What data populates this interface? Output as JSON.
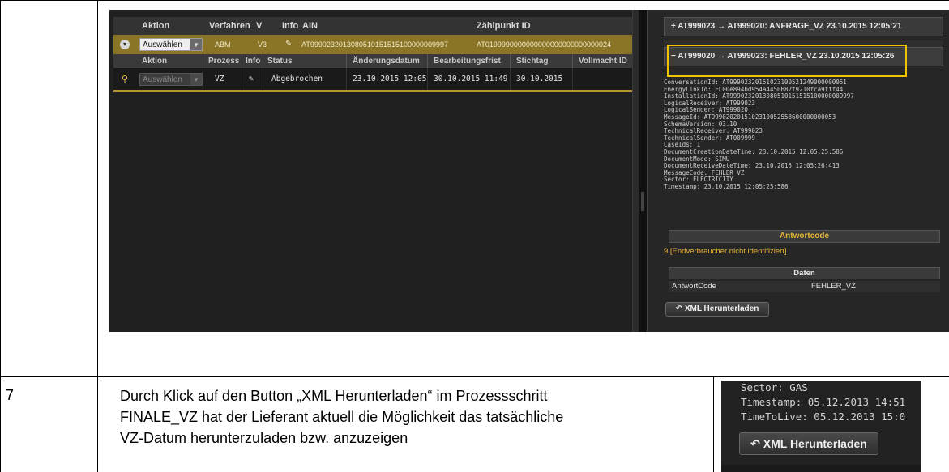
{
  "top_table": {
    "headers": [
      "Aktion",
      "Verfahren",
      "V",
      "Info",
      "AIN",
      "Zählpunkt ID"
    ],
    "row": {
      "action_select": "Auswählen",
      "verfahren": "ABM",
      "version": "V3",
      "ain": "AT9990232013080510151515100000009997",
      "zaehlpunkt": "AT0199990000000000000000000000024"
    }
  },
  "sub_table": {
    "headers": [
      "Aktion",
      "Prozess",
      "Info",
      "Status",
      "Änderungsdatum",
      "Bearbeitungsfrist",
      "Stichtag",
      "Vollmacht ID"
    ],
    "row": {
      "action_select": "Auswählen",
      "prozess": "VZ",
      "status": "Abgebrochen",
      "aenderungsdatum": "23.10.2015 12:05",
      "bearbeitungsfrist": "30.10.2015 11:49",
      "stichtag": "30.10.2015",
      "vollmacht": ""
    }
  },
  "messages": {
    "collapsed_title": "AT999023 → AT999020: ANFRAGE_VZ 23.10.2015 12:05:21",
    "expanded_title": "AT999020 → AT999023: FEHLER_VZ 23.10.2015 12:05:26",
    "details": [
      "ConversationId: AT99902320151023100521249000000051",
      "EnergyLinkId: EL00e894bd954a4450682f9210fca9fff44",
      "InstallationId: AT9990232013080510151515100000009997",
      "LogicalReceiver: AT999023",
      "LogicalSender: AT999020",
      "MessageId: AT9990202015102310052558600000000053",
      "SchemaVersion: 03.10",
      "TechnicalReceiver: AT999023",
      "TechnicalSender: AT009999",
      "CaseIds: 1",
      "DocumentCreationDateTime: 23.10.2015 12:05:25:586",
      "DocumentMode: SIMU",
      "DocumentReceiveDateTime: 23.10.2015 12:05:26:413",
      "MessageCode: FEHLER_VZ",
      "Sector: ELECTRICITY",
      "Timestamp: 23.10.2015 12:05:25:586"
    ],
    "antwortcode_header": "Antwortcode",
    "antwortcode_value": "9 [Endverbraucher nicht identifiziert]",
    "daten_header": "Daten",
    "daten_key": "AntwortCode",
    "daten_value": "FEHLER_VZ",
    "download_button": "XML Herunterladen"
  },
  "doc_row": {
    "number": "7",
    "lines": [
      "Durch Klick auf den Button „XML Herunterladen“ im Prozessschritt",
      "FINALE_VZ hat der Lieferant aktuell die Möglichkeit das tatsächliche",
      "VZ-Datum herunterzuladen bzw. anzuzeigen"
    ]
  },
  "thumb": {
    "lines": [
      "Sector: GAS",
      "Timestamp: 05.12.2013 14:51",
      "TimeToLive: 05.12.2013 15:0"
    ],
    "button": "XML Herunterladen"
  },
  "colors": {
    "highlight": "#f2c500",
    "selected_row": "#8a7526",
    "antwort_text": "#e8b73a"
  }
}
